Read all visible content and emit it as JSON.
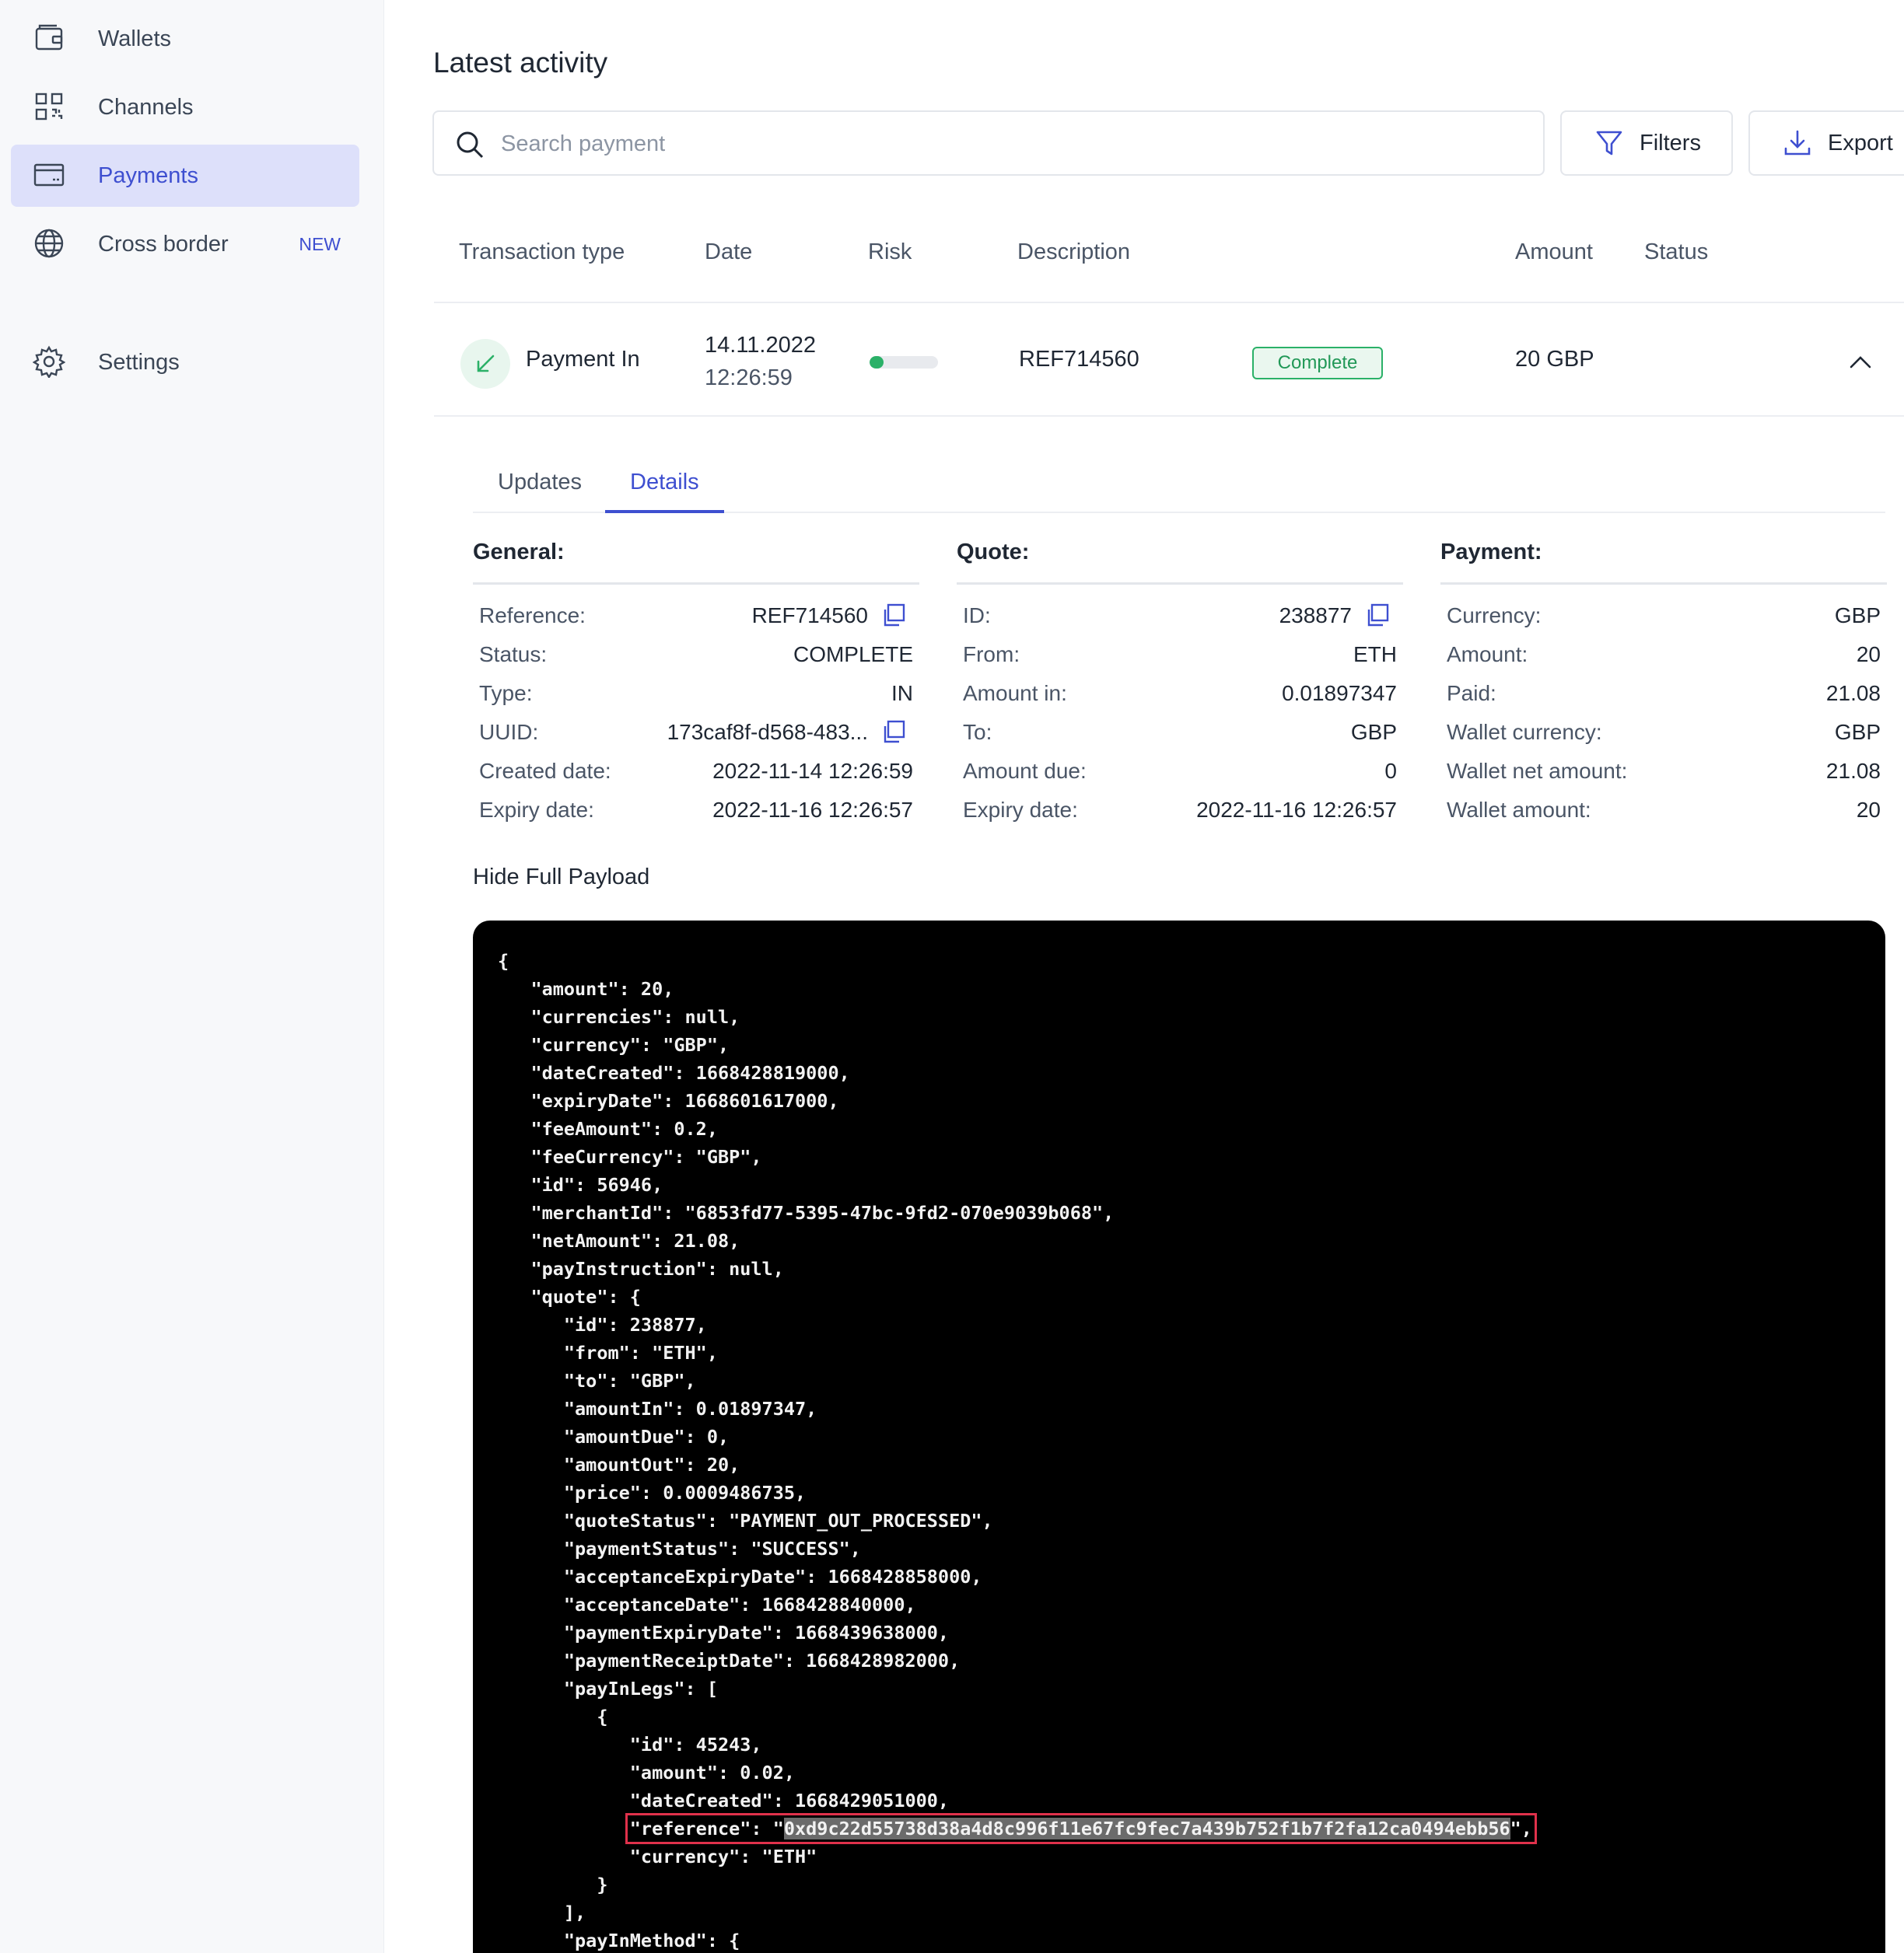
{
  "sidebar": {
    "items": [
      {
        "label": "Wallets",
        "icon": "wallet-icon"
      },
      {
        "label": "Channels",
        "icon": "qr-grid-icon"
      },
      {
        "label": "Payments",
        "icon": "card-icon",
        "active": true
      },
      {
        "label": "Cross border",
        "icon": "globe-icon",
        "badge": "NEW"
      },
      {
        "label": "Settings",
        "icon": "gear-icon"
      }
    ]
  },
  "main": {
    "title": "Latest activity",
    "search": {
      "placeholder": "Search payment",
      "value": ""
    },
    "filters_label": "Filters",
    "export_label": "Export"
  },
  "table": {
    "headers": {
      "type": "Transaction type",
      "date": "Date",
      "risk": "Risk",
      "description": "Description",
      "amount": "Amount",
      "status": "Status"
    },
    "row": {
      "type": "Payment In",
      "date": "14.11.2022",
      "time": "12:26:59",
      "risk_fraction": 0.2,
      "description": "REF714560",
      "amount": "20 GBP",
      "status": "Complete"
    }
  },
  "tabs": [
    {
      "label": "Updates"
    },
    {
      "label": "Details",
      "active": true
    }
  ],
  "details": {
    "general": {
      "title": "General:",
      "reference_label": "Reference:",
      "reference": "REF714560",
      "status_label": "Status:",
      "status": "COMPLETE",
      "type_label": "Type:",
      "type": "IN",
      "uuid_label": "UUID:",
      "uuid": "173caf8f-d568-483...",
      "created_label": "Created date:",
      "created": "2022-11-14 12:26:59",
      "expiry_label": "Expiry date:",
      "expiry": "2022-11-16 12:26:57"
    },
    "quote": {
      "title": "Quote:",
      "id_label": "ID:",
      "id": "238877",
      "from_label": "From:",
      "from": "ETH",
      "amount_in_label": "Amount in:",
      "amount_in": "0.01897347",
      "to_label": "To:",
      "to": "GBP",
      "amount_due_label": "Amount due:",
      "amount_due": "0",
      "expiry_label": "Expiry date:",
      "expiry": "2022-11-16 12:26:57"
    },
    "payment": {
      "title": "Payment:",
      "currency_label": "Currency:",
      "currency": "GBP",
      "amount_label": "Amount:",
      "amount": "20",
      "paid_label": "Paid:",
      "paid": "21.08",
      "wallet_currency_label": "Wallet currency:",
      "wallet_currency": "GBP",
      "wallet_net_amount_label": "Wallet net amount:",
      "wallet_net_amount": "21.08",
      "wallet_amount_label": "Wallet amount:",
      "wallet_amount": "20"
    }
  },
  "payload": {
    "toggle_label": "Hide Full Payload",
    "lines_before": "{\n   \"amount\": 20,\n   \"currencies\": null,\n   \"currency\": \"GBP\",\n   \"dateCreated\": 1668428819000,\n   \"expiryDate\": 1668601617000,\n   \"feeAmount\": 0.2,\n   \"feeCurrency\": \"GBP\",\n   \"id\": 56946,\n   \"merchantId\": \"6853fd77-5395-47bc-9fd2-070e9039b068\",\n   \"netAmount\": 21.08,\n   \"payInstruction\": null,\n   \"quote\": {\n      \"id\": 238877,\n      \"from\": \"ETH\",\n      \"to\": \"GBP\",\n      \"amountIn\": 0.01897347,\n      \"amountDue\": 0,\n      \"amountOut\": 20,\n      \"price\": 0.0009486735,\n      \"quoteStatus\": \"PAYMENT_OUT_PROCESSED\",\n      \"paymentStatus\": \"SUCCESS\",\n      \"acceptanceExpiryDate\": 1668428858000,\n      \"acceptanceDate\": 1668428840000,\n      \"paymentExpiryDate\": 1668439638000,\n      \"paymentReceiptDate\": 1668428982000,\n      \"payInLegs\": [\n         {\n            \"id\": 45243,\n            \"amount\": 0.02,\n            \"dateCreated\": 1668429051000,\n            ",
    "ref_prefix": "\"reference\": \"",
    "ref_value": "0xd9c22d55738d38a4d8c996f11e67fc9fec7a439b752f1b7f2fa12ca0494ebb56",
    "ref_suffix": "\",",
    "lines_after": "\n            \"currency\": \"ETH\"\n         }\n      ],\n      \"payInMethod\": {"
  },
  "colors": {
    "accent": "#3e4fd0",
    "active_nav_bg": "#dde0fa",
    "success": "#2bb168",
    "highlight_border": "#e0314b"
  }
}
